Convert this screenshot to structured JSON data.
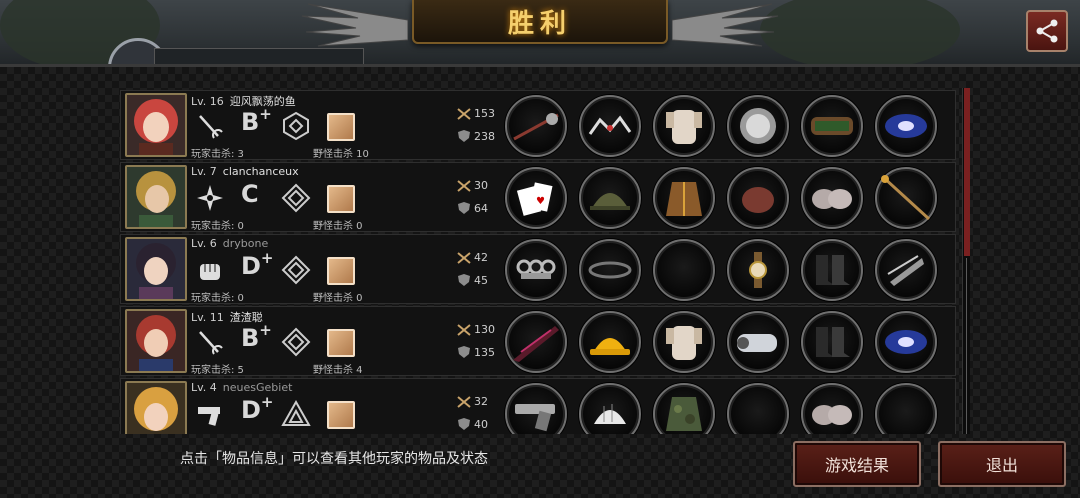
{
  "header": {
    "title": "胜利"
  },
  "players": [
    {
      "level_text": "Lv. 16",
      "name": "迎风飘荡的鱼",
      "rank_letter": "B",
      "rank_plus": "+",
      "weapon_icon": "rapier-icon",
      "rank_icon": "crystal-emblem-icon",
      "player_kills": "玩家击杀: 3",
      "monster_kills": "野怪击杀 10",
      "attack": "153",
      "defense": "238",
      "items": [
        "spiked-mace-icon",
        "tiara-icon",
        "armor-icon",
        "shield-disc-icon",
        "bracer-icon",
        "galaxy-orb-icon"
      ]
    },
    {
      "level_text": "Lv. 7",
      "name": "clanchanceux",
      "rank_letter": "C",
      "rank_plus": "",
      "weapon_icon": "shuriken-icon",
      "rank_icon": "diamond-emblem-icon",
      "player_kills": "玩家击杀: 0",
      "monster_kills": "野怪击杀 0",
      "attack": "30",
      "defense": "64",
      "items": [
        "playing-cards-icon",
        "helmet-icon",
        "jacket-icon",
        "leather-pouch-icon",
        "slippers-icon",
        "staff-icon"
      ]
    },
    {
      "level_text": "Lv. 6",
      "name": "drybone",
      "rank_letter": "D",
      "rank_plus": "+",
      "weapon_icon": "fist-icon",
      "rank_icon": "diamond-emblem-icon",
      "player_kills": "玩家击杀: 0",
      "monster_kills": "野怪击杀 0",
      "attack": "42",
      "defense": "45",
      "items": [
        "brass-knuckles-icon",
        "headband-icon",
        "empty-slot",
        "wristwatch-icon",
        "boots-icon",
        "armor-plate-icon"
      ]
    },
    {
      "level_text": "Lv. 11",
      "name": "渣渣聪",
      "rank_letter": "B",
      "rank_plus": "+",
      "weapon_icon": "rapier-icon",
      "rank_icon": "diamond-emblem-icon",
      "player_kills": "玩家击杀: 5",
      "monster_kills": "野怪击杀 4",
      "attack": "130",
      "defense": "135",
      "items": [
        "dark-blade-icon",
        "hard-hat-icon",
        "armor-icon",
        "gauntlet-icon",
        "boots-icon",
        "galaxy-orb-icon"
      ]
    },
    {
      "level_text": "Lv. 4",
      "name": "neuesGebiet",
      "rank_letter": "D",
      "rank_plus": "+",
      "weapon_icon": "pistol-icon",
      "rank_icon": "triangle-emblem-icon",
      "player_kills": "",
      "monster_kills": "",
      "attack": "32",
      "defense": "40",
      "items": [
        "pistol-item-icon",
        "bike-helmet-icon",
        "camo-jacket-icon",
        "empty-slot",
        "slippers-icon",
        "empty-slot"
      ]
    }
  ],
  "footer": {
    "hint": "点击「物品信息」可以查看其他玩家的物品及状态",
    "results_label": "游戏结果",
    "exit_label": "退出"
  },
  "colors": {
    "accent": "#f5cf6d",
    "button": "#5a2018",
    "scroll_thumb": "#7a2020"
  }
}
